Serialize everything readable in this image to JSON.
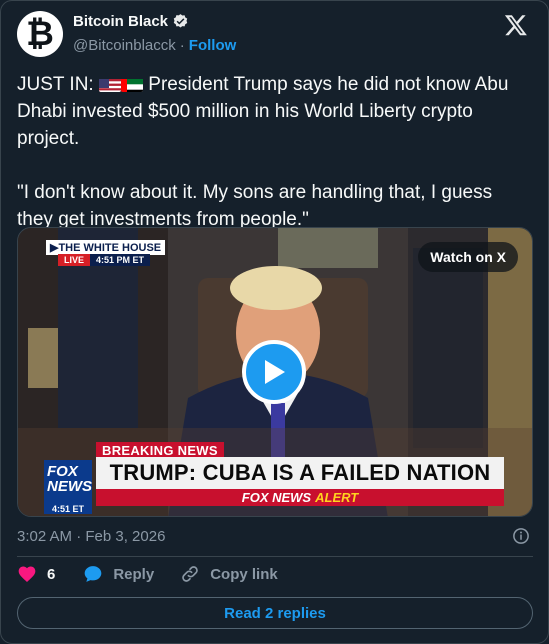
{
  "author": {
    "display_name": "Bitcoin Black",
    "handle": "@Bitcoinblacck",
    "separator": "·",
    "follow_label": "Follow",
    "avatar_glyph": "₿"
  },
  "tweet": {
    "prefix": "JUST IN: ",
    "after_flags": " President Trump says he did not know Abu Dhabi invested $500 million in his World Liberty crypto project.",
    "quote": "\"I don't know about it. My sons are handling that, I guess they get investments from people.\"",
    "flags": [
      "us-flag-icon",
      "uae-flag-icon"
    ]
  },
  "media": {
    "watch_label": "Watch on X",
    "broadcast_location": "▶THE WHITE HOUSE",
    "live_label": "LIVE",
    "live_time": "4:51 PM ET",
    "breaking_label": "BREAKING NEWS",
    "headline": "TRUMP: CUBA IS A FAILED NATION",
    "alert_brand": "FOX NEWS",
    "alert_word": "ALERT",
    "network_logo": "FOX NEWS",
    "network_time": "4:51 ET"
  },
  "meta": {
    "timestamp": "3:02 AM · Feb 3, 2026"
  },
  "engagement": {
    "like_count": "6",
    "reply_label": "Reply",
    "copy_link_label": "Copy link",
    "read_replies_label": "Read 2 replies"
  },
  "colors": {
    "background": "#15202b",
    "accent": "#1d9bf0",
    "like": "#f91880",
    "muted": "#8b98a5"
  }
}
